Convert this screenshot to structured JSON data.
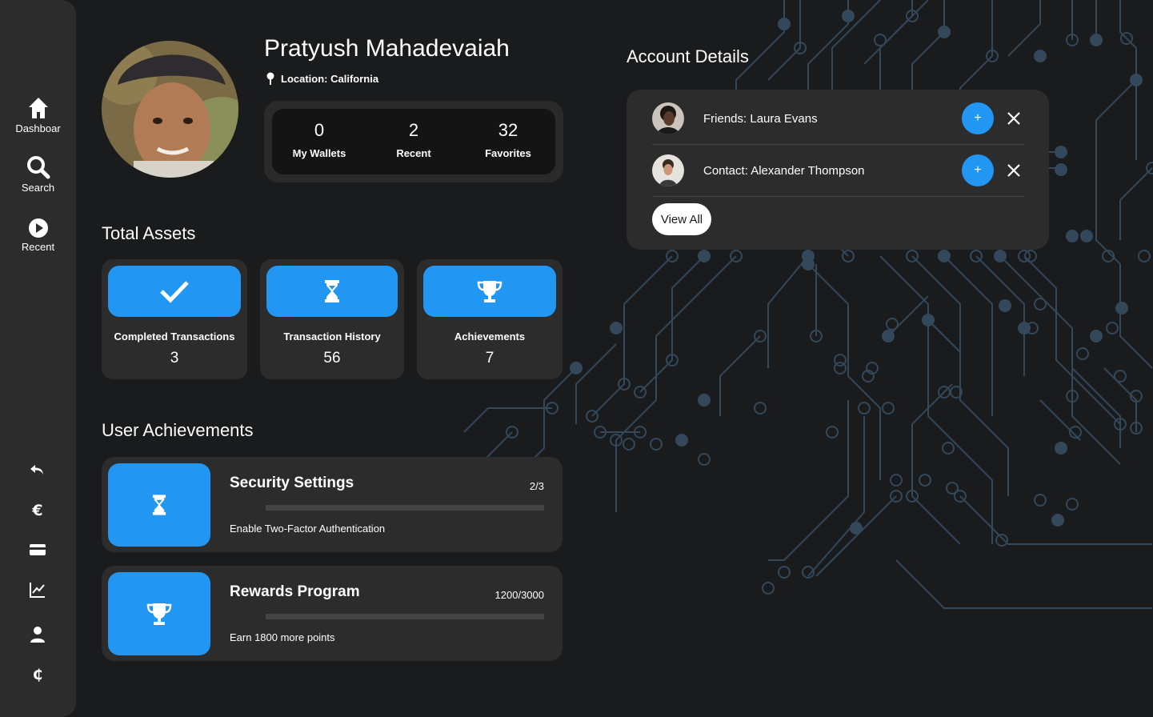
{
  "sidebar": {
    "nav": [
      {
        "label": "Dashboar",
        "icon": "home-icon"
      },
      {
        "label": "Search",
        "icon": "search-icon"
      },
      {
        "label": "Recent",
        "icon": "play-circle-icon"
      }
    ],
    "tools": [
      "undo-icon",
      "euro-icon",
      "credit-card-icon",
      "line-chart-icon",
      "user-icon",
      "cedi-icon"
    ]
  },
  "profile": {
    "name": "Pratyush Mahadevaiah",
    "location": "Location: California",
    "stats": [
      {
        "value": "0",
        "label": "My Wallets"
      },
      {
        "value": "2",
        "label": "Recent"
      },
      {
        "value": "32",
        "label": "Favorites"
      }
    ]
  },
  "total_assets": {
    "title": "Total Assets",
    "cards": [
      {
        "title": "Completed Transactions",
        "value": "3",
        "icon": "check-icon"
      },
      {
        "title": "Transaction History",
        "value": "56",
        "icon": "hourglass-icon"
      },
      {
        "title": "Achievements",
        "value": "7",
        "icon": "trophy-icon"
      }
    ]
  },
  "user_achievements": {
    "title": "User Achievements",
    "items": [
      {
        "title": "Security Settings",
        "progress": "2/3",
        "description": "Enable Two-Factor Authentication",
        "fraction": 0,
        "icon": "hourglass-icon"
      },
      {
        "title": "Rewards Program",
        "progress": "1200/3000",
        "description": "Earn 1800 more points",
        "fraction": 0,
        "icon": "trophy-icon"
      }
    ]
  },
  "account_details": {
    "title": "Account Details",
    "rows": [
      {
        "text": "Friends: Laura Evans",
        "add_label": "+"
      },
      {
        "text": "Contact: Alexander Thompson",
        "add_label": "+"
      }
    ],
    "view_all": "View All"
  },
  "colors": {
    "accent": "#2196f3",
    "background": "#1a1b1c",
    "card": "#2c2c2c",
    "circuit": "#33485a"
  }
}
